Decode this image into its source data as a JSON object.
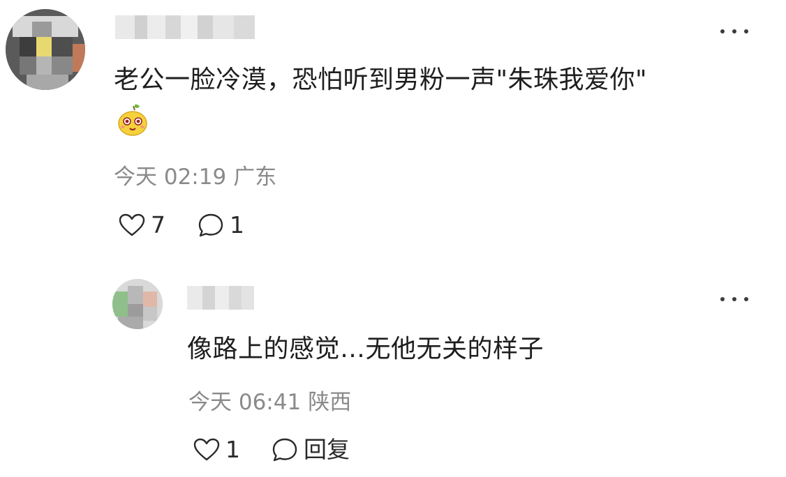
{
  "comment": {
    "text": "老公一脸冷漠，恐怕听到男粉一声\"朱珠我爱你\"",
    "time": "今天 02:19",
    "location": "广东",
    "likes": "7",
    "replies": "1",
    "emoji_icon": "smiling-face-emoji"
  },
  "reply": {
    "text": "像路上的感觉…无他无关的样子",
    "time": "今天 06:41",
    "location": "陕西",
    "likes": "1",
    "reply_label": "回复"
  },
  "colors": {
    "text": "#1e1e1e",
    "meta": "#8a8a8a",
    "icon": "#2a2a2a",
    "background": "#ffffff"
  }
}
